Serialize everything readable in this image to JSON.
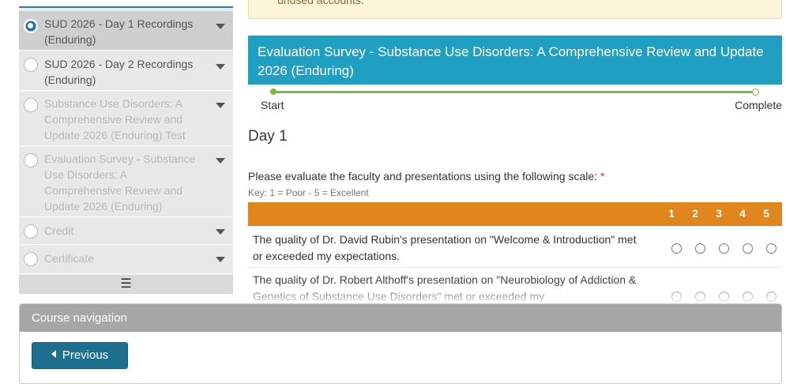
{
  "sidebar": {
    "items": [
      {
        "label": "SUD 2026 - Day 1 Recordings (Enduring)",
        "state": "active"
      },
      {
        "label": "SUD 2026 - Day 2 Recordings (Enduring)",
        "state": "available"
      },
      {
        "label": "Substance Use Disorders: A Comprehensive Review and Update 2026 (Enduring) Test",
        "state": "disabled"
      },
      {
        "label": "Evaluation Survey - Substance Use Disorders: A Comprehensive Review and Update 2026 (Enduring)",
        "state": "disabled"
      },
      {
        "label": "Credit",
        "state": "disabled"
      },
      {
        "label": "Certificate",
        "state": "disabled"
      }
    ],
    "menu_icon": "☰"
  },
  "notice": {
    "text": "unused accounts."
  },
  "survey": {
    "title": "Evaluation Survey - Substance Use Disorders: A Comprehensive Review and Update 2026 (Enduring)",
    "progress": {
      "start_label": "Start",
      "end_label": "Complete",
      "fraction": 0
    },
    "section_title": "Day 1",
    "question": "Please evaluate the faculty and presentations using the following scale:",
    "required_mark": "*",
    "key": "Key: 1 = Poor - 5 = Excellent",
    "scale": [
      "1",
      "2",
      "3",
      "4",
      "5"
    ],
    "rows": [
      {
        "text": "The quality of Dr. David Rubin's presentation on \"Welcome & Introduction\" met or exceeded my expectations."
      },
      {
        "text": "The quality of Dr. Robert Althoff's presentation on \"Neurobiology of Addiction & Genetics of Substance Use Disorders\" met or exceeded my"
      }
    ]
  },
  "course_nav": {
    "title": "Course navigation",
    "previous_label": "Previous"
  },
  "colors": {
    "survey_header": "#1fa0c3",
    "scale_header": "#e0861d",
    "progress": "#7cba3f",
    "previous_button": "#1d6f8f",
    "nav_header": "#a6a6a6"
  }
}
